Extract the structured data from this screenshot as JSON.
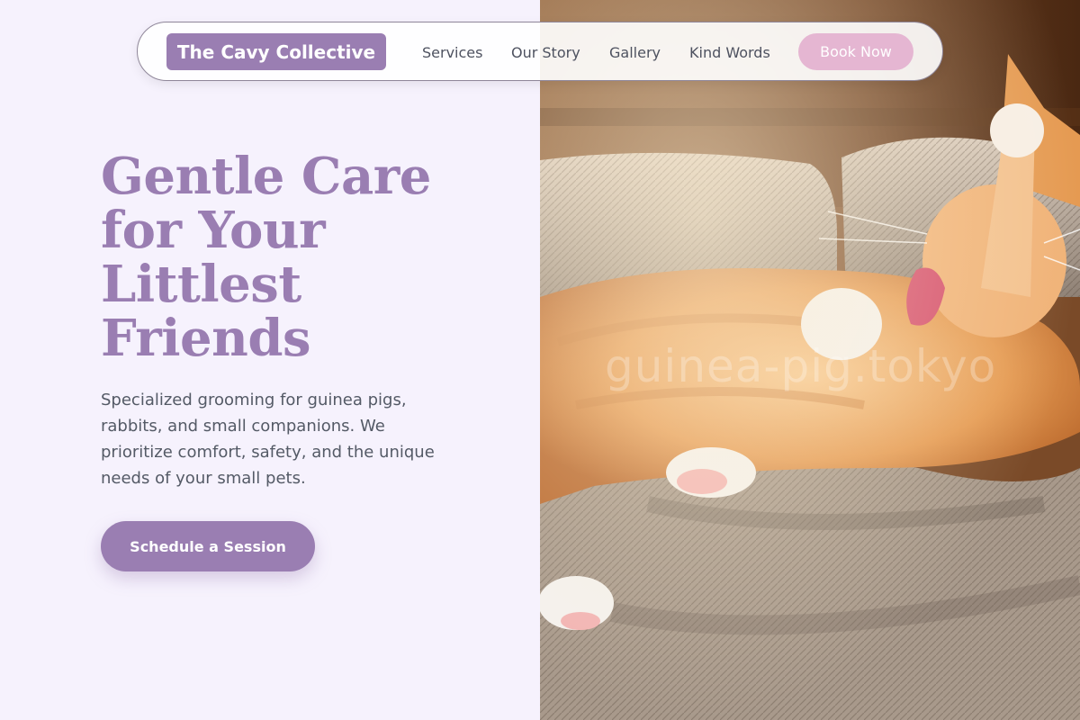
{
  "nav": {
    "brand": "The Cavy Collective",
    "links": [
      "Services",
      "Our Story",
      "Gallery",
      "Kind Words"
    ],
    "book_label": "Book Now"
  },
  "hero": {
    "title_lines": [
      "Gentle Care",
      "for Your",
      "Littlest",
      "Friends"
    ],
    "description": "Specialized grooming for guinea pigs, rabbits, and small companions. We prioritize comfort, safety, and the unique needs of your small pets.",
    "cta_label": "Schedule a Session"
  },
  "photo": {
    "watermark": "guinea-pig.tokyo"
  },
  "colors": {
    "accent": "#9a7eb2",
    "pink": "#e5b6d2",
    "background": "#f6f2fd",
    "text": "#545a66"
  }
}
